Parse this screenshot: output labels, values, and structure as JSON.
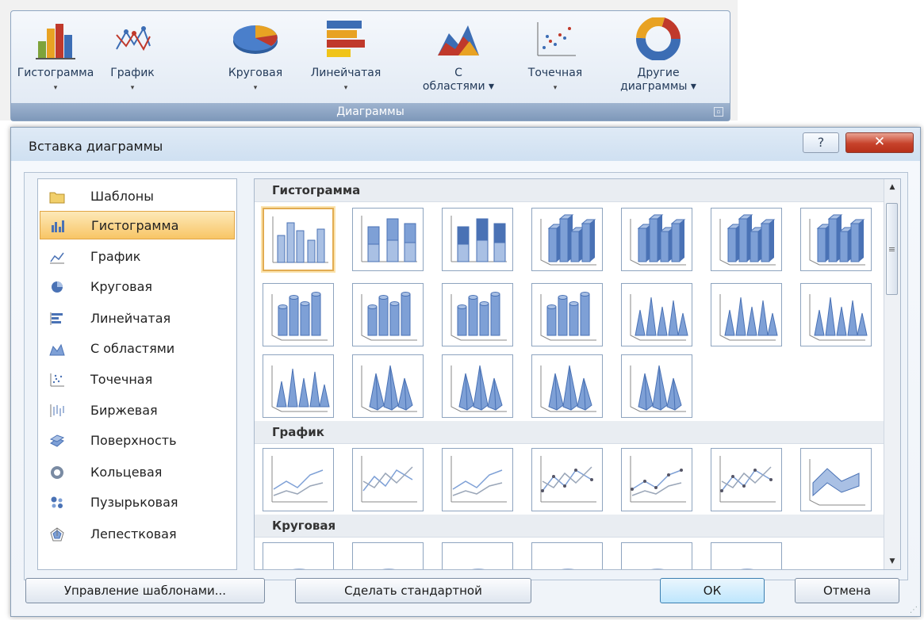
{
  "ribbon": {
    "group_title": "Диаграммы",
    "buttons": [
      {
        "label": "Гистограмма",
        "icon": "column-chart-icon",
        "arrow": "▾"
      },
      {
        "label": "График",
        "icon": "line-chart-icon",
        "arrow": "▾"
      },
      {
        "label": "Круговая",
        "icon": "pie-chart-icon",
        "arrow": "▾"
      },
      {
        "label": "Линейчатая",
        "icon": "bar-chart-icon",
        "arrow": "▾"
      },
      {
        "label": "С областями",
        "line1": "С",
        "line2": "областями ▾",
        "icon": "area-chart-icon"
      },
      {
        "label": "Точечная",
        "icon": "scatter-chart-icon",
        "arrow": "▾"
      },
      {
        "label": "Другие диаграммы",
        "line1": "Другие",
        "line2": "диаграммы ▾",
        "icon": "other-charts-icon"
      }
    ],
    "launcher": "▫"
  },
  "dialog": {
    "title": "Вставка диаграммы",
    "help_label": "?",
    "close_label": "✕",
    "chart_types": [
      {
        "label": "Шаблоны",
        "icon": "folder-icon"
      },
      {
        "label": "Гистограмма",
        "icon": "column-chart-icon",
        "selected": true
      },
      {
        "label": "График",
        "icon": "line-chart-icon"
      },
      {
        "label": "Круговая",
        "icon": "pie-chart-icon"
      },
      {
        "label": "Линейчатая",
        "icon": "bar-chart-icon"
      },
      {
        "label": "С областями",
        "icon": "area-chart-icon"
      },
      {
        "label": "Точечная",
        "icon": "scatter-chart-icon"
      },
      {
        "label": "Биржевая",
        "icon": "stock-chart-icon"
      },
      {
        "label": "Поверхность",
        "icon": "surface-chart-icon"
      },
      {
        "label": "Кольцевая",
        "icon": "doughnut-chart-icon"
      },
      {
        "label": "Пузырьковая",
        "icon": "bubble-chart-icon"
      },
      {
        "label": "Лепестковая",
        "icon": "radar-chart-icon"
      }
    ],
    "sections": [
      {
        "title": "Гистограмма",
        "subtypes": 19
      },
      {
        "title": "График",
        "subtypes": 7
      },
      {
        "title": "Круговая",
        "subtypes": 6
      }
    ],
    "buttons": {
      "manage_templates": "Управление шаблонами...",
      "set_default": "Сделать стандартной",
      "ok": "ОК",
      "cancel": "Отмена"
    },
    "scroll": {
      "up": "▲",
      "down": "▼",
      "thumb": "≡"
    }
  },
  "colors": {
    "accent_blue": "#4a72b5",
    "selection": "#f8c566",
    "close_red": "#c7422b"
  }
}
